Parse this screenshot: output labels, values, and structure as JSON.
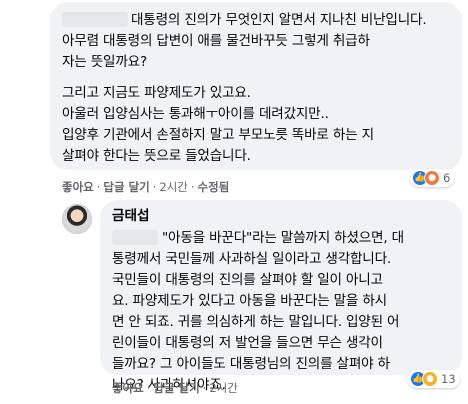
{
  "comment1": {
    "author_blurred": true,
    "paragraph1": [
      "대통령의 진의가 무엇인지 알면서 지나친 비난입니다.",
      "아무렴 대통령의 답변이 애를 물건바꾸듯 그렇게 취급하",
      "자는 뜻일까요?"
    ],
    "paragraph2": [
      "그리고 지금도 파양제도가 있고요.",
      "아울러 입양심사는 통과해ㅜ아이를 데려갔지만..",
      "입양후 기관에서 손절하지 말고 부모노릇 똑바로 하는 지",
      "살펴야 한다는 뜻으로 들었습니다."
    ],
    "actions": {
      "like": "좋아요",
      "reply": "답글 달기",
      "time": "2시간",
      "edited": "수정됨"
    },
    "reactions": {
      "icons": [
        "like-icon",
        "angry-icon"
      ],
      "count": "6"
    }
  },
  "comment2": {
    "author": "금태섭",
    "quote_rest": "\"아동을 바꾼다\"라는 말씀까지 하셨으면, 대",
    "lines": [
      "통령께서 국민들께 사과하실 일이라고 생각합니다.",
      "국민들이 대통령의 진의를 살펴야 할 일이 아니고",
      "요. 파양제도가 있다고 아동을 바꾼다는 말을 하시",
      "면 안 되죠. 귀를 의심하게 하는 말입니다. 입양된 어",
      "린이들이 대통령의 저 발언을 들으면 무슨 생각이",
      "들까요? 그 아이들도 대통령님의 진의를 살펴야 하",
      "나요? 사과하셔야죠."
    ],
    "actions": {
      "like": "좋아요",
      "reply": "답글 달기",
      "time": "2시간"
    },
    "reactions": {
      "icons": [
        "like-icon",
        "sad-icon"
      ],
      "count": "13"
    }
  },
  "colors": {
    "bubble": "#f0f2f5",
    "meta": "#65676b",
    "like_blue": "#1877f2"
  }
}
